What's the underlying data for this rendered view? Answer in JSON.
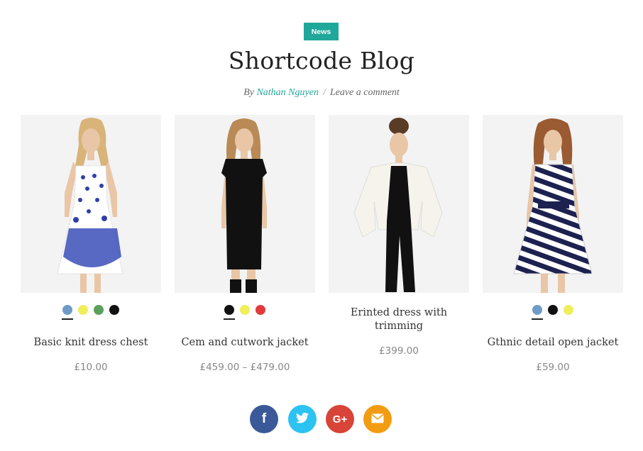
{
  "post": {
    "category": "News",
    "title": "Shortcode Blog",
    "by_label": "By",
    "author": "Nathan Nguyen",
    "separator": "/",
    "comment_link": "Leave a comment"
  },
  "products": [
    {
      "name": "Basic knit dress chest",
      "price": "£10.00",
      "swatches": [
        "#6f9bc7",
        "#f0ee5a",
        "#5aa05a",
        "#111111"
      ]
    },
    {
      "name": "Cem and cutwork jacket",
      "price": "£459.00 – £479.00",
      "swatches": [
        "#111111",
        "#f0ee5a",
        "#e23a3a"
      ]
    },
    {
      "name": "Erinted dress with trimming",
      "price": "£399.00",
      "swatches": []
    },
    {
      "name": "Gthnic detail open jacket",
      "price": "£59.00",
      "swatches": [
        "#6f9bc7",
        "#111111",
        "#f0ee5a"
      ]
    }
  ],
  "share": [
    {
      "icon": "facebook-icon",
      "glyph": "f",
      "color": "#3b5998"
    },
    {
      "icon": "twitter-icon",
      "glyph": "t",
      "color": "#2cc2f1"
    },
    {
      "icon": "google-plus-icon",
      "glyph": "G+",
      "color": "#d84438"
    },
    {
      "icon": "email-icon",
      "glyph": "✉",
      "color": "#f39c12"
    }
  ]
}
